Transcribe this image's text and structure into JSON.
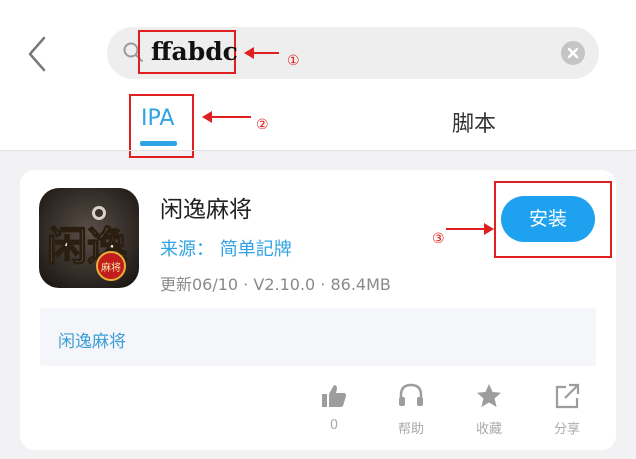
{
  "header": {
    "search": {
      "query": "ffabdc"
    },
    "tabs": [
      {
        "label": "IPA"
      },
      {
        "label": "脚本"
      }
    ]
  },
  "annotations": {
    "one": "①",
    "two": "②",
    "three": "③"
  },
  "app": {
    "name": "闲逸麻将",
    "source": "来源： 简单記牌",
    "meta": "更新06/10 · V2.10.0 · 86.4MB",
    "install_label": "安装",
    "description": "闲逸麻将",
    "icon_text": {
      "main": "闲逸",
      "sub": "麻将"
    }
  },
  "actions": [
    {
      "label": "0",
      "icon": "thumbs-up-icon"
    },
    {
      "label": "帮助",
      "icon": "headset-icon"
    },
    {
      "label": "收藏",
      "icon": "star-icon"
    },
    {
      "label": "分享",
      "icon": "share-icon"
    }
  ],
  "colors": {
    "accent": "#2fa3e6",
    "install": "#1ea2ef",
    "annotation": "#e02020"
  }
}
